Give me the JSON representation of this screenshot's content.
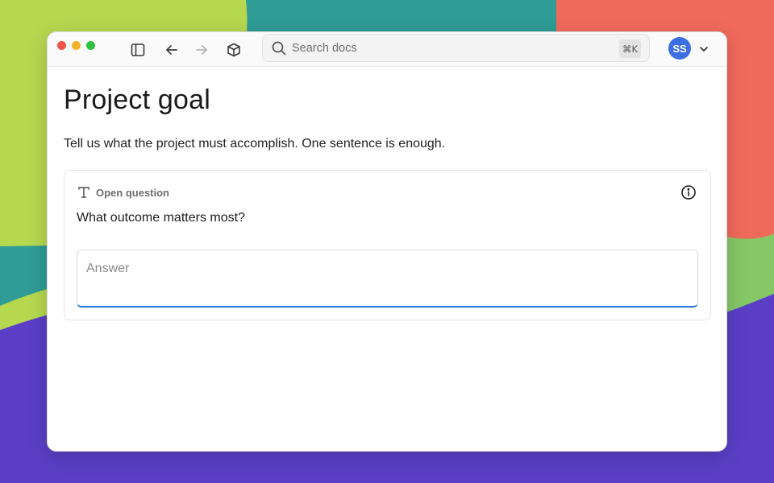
{
  "window": {
    "traffic_lights": {
      "close": "#f0524c",
      "minimize": "#f5b32a",
      "zoom": "#2cc240"
    },
    "toolbar": {
      "sidebar_icon": "sidebar-toggle-icon",
      "back_icon": "arrow-left-icon",
      "forward_icon": "arrow-right-icon",
      "package_icon": "cube-icon"
    },
    "search": {
      "placeholder": "Search docs",
      "shortcut": "⌘K"
    },
    "user": {
      "initials": "SS",
      "avatar_color": "#3d6fe3"
    }
  },
  "page": {
    "title": "Project goal",
    "description": "Tell us what the project must accomplish. One sentence is enough."
  },
  "question": {
    "type_label": "Open question",
    "type_icon": "text-type-icon",
    "text": "What outcome matters most?",
    "answer_placeholder": "Answer",
    "answer_value": "",
    "accent_color": "#1f79d6"
  }
}
